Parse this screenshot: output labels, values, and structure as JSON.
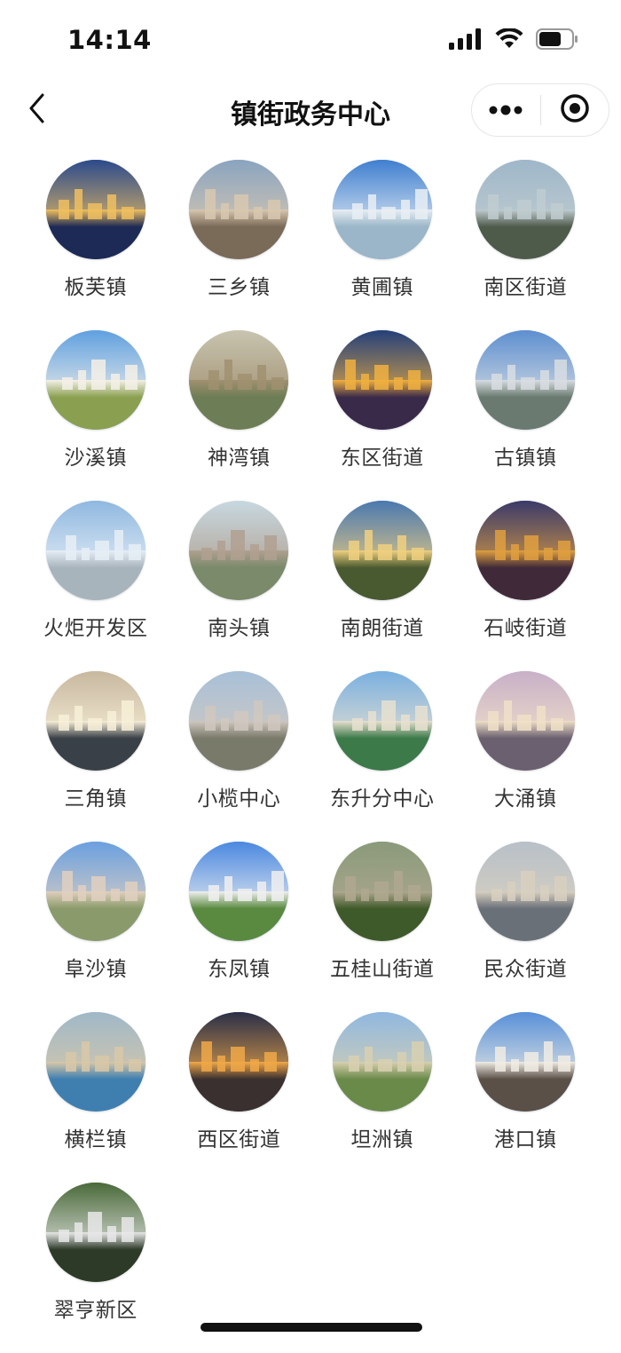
{
  "status": {
    "time": "14:14",
    "icons": [
      "cellular-signal-icon",
      "wifi-icon",
      "battery-icon"
    ]
  },
  "nav": {
    "title": "镇街政务中心",
    "back_icon": "chevron-left-icon",
    "capsule_icons": [
      "more-dots-icon",
      "close-target-icon"
    ]
  },
  "items": [
    {
      "label": "板芙镇",
      "sky": "#2b4a8c",
      "ground": "#1c2a55",
      "accent": "#f0c060"
    },
    {
      "label": "三乡镇",
      "sky": "#8aa4c0",
      "ground": "#7a6a58",
      "accent": "#d8c8b0"
    },
    {
      "label": "黄圃镇",
      "sky": "#3f7fd0",
      "ground": "#9ab6c8",
      "accent": "#e8eef4"
    },
    {
      "label": "南区街道",
      "sky": "#9fb7c9",
      "ground": "#4e5a4a",
      "accent": "#c0ccd0"
    },
    {
      "label": "沙溪镇",
      "sky": "#5fa0e0",
      "ground": "#8aa050",
      "accent": "#f4f0e8"
    },
    {
      "label": "神湾镇",
      "sky": "#c8c4b0",
      "ground": "#6d7d55",
      "accent": "#a09070"
    },
    {
      "label": "东区街道",
      "sky": "#24407a",
      "ground": "#3a2a4a",
      "accent": "#f0b040"
    },
    {
      "label": "古镇镇",
      "sky": "#5d8fd0",
      "ground": "#6a7a70",
      "accent": "#d8dde2"
    },
    {
      "label": "火炬开发区",
      "sky": "#8fb8e0",
      "ground": "#a8b4bc",
      "accent": "#e6eef6"
    },
    {
      "label": "南头镇",
      "sky": "#c8d8e0",
      "ground": "#7a8a6a",
      "accent": "#b0a090"
    },
    {
      "label": "南朗街道",
      "sky": "#4a78b0",
      "ground": "#4a5a30",
      "accent": "#f0d080"
    },
    {
      "label": "石岐街道",
      "sky": "#3a3a6a",
      "ground": "#402a3a",
      "accent": "#e0a040"
    },
    {
      "label": "三角镇",
      "sky": "#c8b8a0",
      "ground": "#3a4048",
      "accent": "#f8f0d8"
    },
    {
      "label": "小榄中心",
      "sky": "#a8c0d8",
      "ground": "#7a7a6a",
      "accent": "#d0c8c0"
    },
    {
      "label": "东升分中心",
      "sky": "#7ab0e0",
      "ground": "#3d7a4a",
      "accent": "#e8e0d0"
    },
    {
      "label": "大涌镇",
      "sky": "#c8b0c8",
      "ground": "#6a6070",
      "accent": "#f0e0c8"
    },
    {
      "label": "阜沙镇",
      "sky": "#6aa0e0",
      "ground": "#8a9a6a",
      "accent": "#e0d0c0"
    },
    {
      "label": "东凤镇",
      "sky": "#4a88e0",
      "ground": "#5a8a40",
      "accent": "#f0f0f0"
    },
    {
      "label": "五桂山街道",
      "sky": "#8a9a7a",
      "ground": "#3f5a2a",
      "accent": "#b0a890"
    },
    {
      "label": "民众街道",
      "sky": "#b8c0c8",
      "ground": "#6a7078",
      "accent": "#d8d0c0"
    },
    {
      "label": "横栏镇",
      "sky": "#a0b8c8",
      "ground": "#3e7fb0",
      "accent": "#d8c8a8"
    },
    {
      "label": "西区街道",
      "sky": "#2a2f48",
      "ground": "#3a3030",
      "accent": "#f0a848"
    },
    {
      "label": "坦洲镇",
      "sky": "#90b8e0",
      "ground": "#6a8a4a",
      "accent": "#d8d0b0"
    },
    {
      "label": "港口镇",
      "sky": "#5890d8",
      "ground": "#5a5048",
      "accent": "#f0ece4"
    },
    {
      "label": "翠亨新区",
      "sky": "#4a6a3a",
      "ground": "#2d3a28",
      "accent": "#e8e8e8"
    }
  ]
}
